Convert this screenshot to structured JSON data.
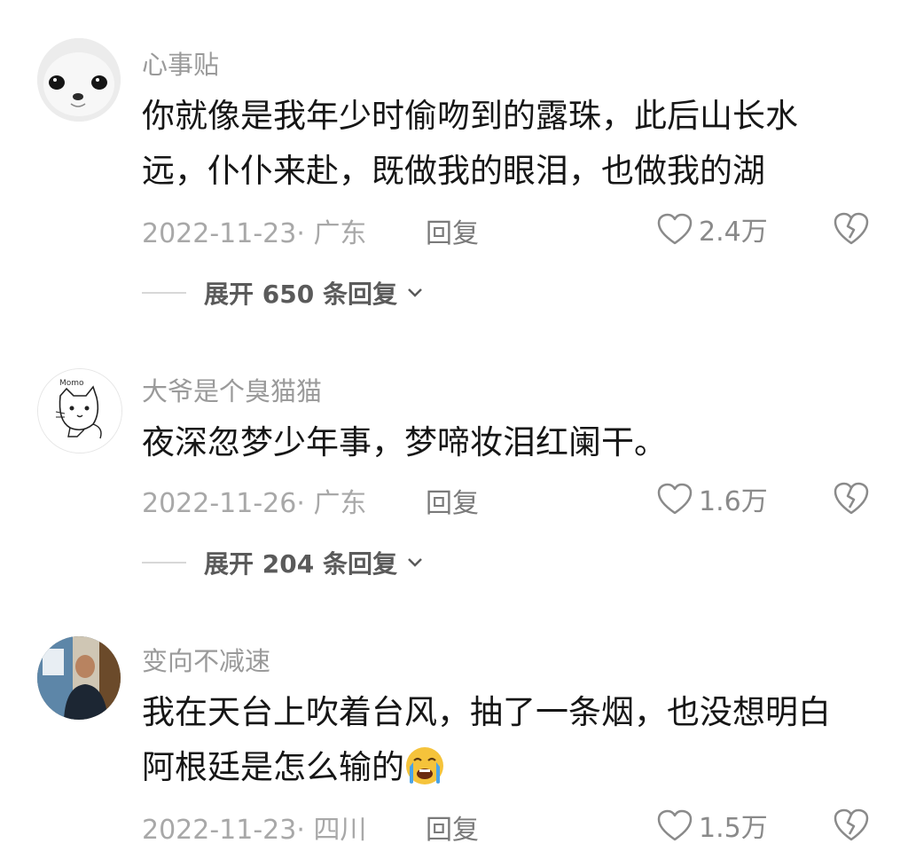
{
  "comments": [
    {
      "username": "心事贴",
      "text": "你就像是我年少时偷吻到的露珠，此后山长水远，仆仆来赴，既做我的眼泪，也做我的湖",
      "date": "2022-11-23·",
      "location": "广东",
      "reply_label": "回复",
      "likes": "2.4万",
      "expand_label": "展开 650 条回复",
      "avatar_icon": "seal-avatar-icon"
    },
    {
      "username": "大爷是个臭猫猫",
      "text": "夜深忽梦少年事，梦啼妆泪红阑干。",
      "date": "2022-11-26·",
      "location": "广东",
      "reply_label": "回复",
      "likes": "1.6万",
      "expand_label": "展开 204 条回复",
      "avatar_icon": "cat-drawing-avatar-icon",
      "avatar_text": "Momo"
    },
    {
      "username": "变向不减速",
      "text": "我在天台上吹着台风，抽了一条烟，也没想明白阿根廷是怎么输的",
      "date": "2022-11-23·",
      "location": "四川",
      "reply_label": "回复",
      "likes": "1.5万",
      "avatar_icon": "person-photo-avatar-icon",
      "trailing_emoji": "loudly-crying-face-emoji"
    }
  ],
  "colors": {
    "username": "#9a9a9a",
    "content": "#161616",
    "meta": "#a8a8a8",
    "emoji_face": "#f5c33b",
    "emoji_tears": "#4aa3e8"
  }
}
